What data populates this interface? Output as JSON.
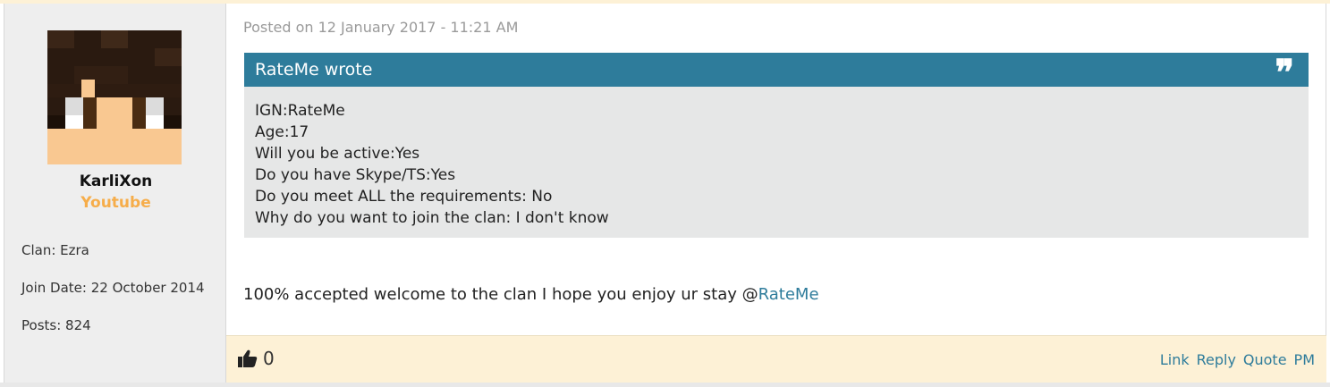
{
  "author": {
    "name": "KarliXon",
    "title": "Youtube",
    "clan": "Clan: Ezra",
    "join_date": "Join Date: 22 October 2014",
    "posts": "Posts: 824"
  },
  "post": {
    "posted": "Posted on 12 January 2017 - 11:21 AM",
    "quote": {
      "header": "RateMe wrote",
      "lines": [
        "IGN:RateMe",
        "Age:17",
        "Will you be active:Yes",
        "Do you have Skype/TS:Yes",
        "Do you meet ALL the requirements: No",
        "Why do you want to join the clan: I don't know"
      ]
    },
    "message_text": "100% accepted welcome to the clan I hope you enjoy ur stay @",
    "mention": "RateMe"
  },
  "footer": {
    "like_count": "0",
    "actions": {
      "link": "Link",
      "reply": "Reply",
      "quote": "Quote",
      "pm": "PM"
    }
  },
  "colors": {
    "accent": "#2e7c9b",
    "user_title": "#f6ad4a",
    "footer_bg": "#fdf1d6",
    "quote_bg": "#e6e7e7"
  }
}
